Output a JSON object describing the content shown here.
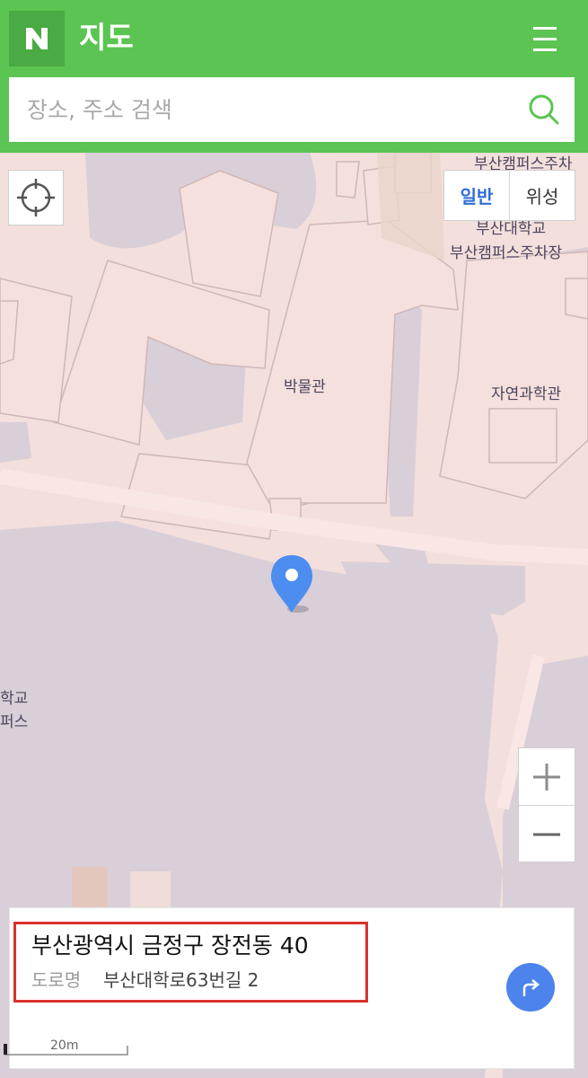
{
  "header": {
    "logo_letter": "N",
    "title": "지도",
    "menu_icon": "hamburger-menu-icon",
    "brand_color": "#5bc452"
  },
  "search": {
    "placeholder": "장소, 주소 검색",
    "value": "",
    "icon": "search-icon"
  },
  "map": {
    "map_type": {
      "options": [
        "일반",
        "위성"
      ],
      "selected": "일반"
    },
    "labels": {
      "parking_top": "부산캠퍼스주차",
      "university": "부산대학교",
      "parking": "부산캠퍼스주차장",
      "museum": "박물관",
      "science_college": "자연과학관",
      "left_edge_1": "학교",
      "left_edge_2": "퍼스"
    },
    "scale": "20m",
    "zoom": {
      "in_icon": "plus-icon",
      "out_icon": "minus-icon"
    },
    "locate_icon": "crosshair-icon",
    "marker_icon": "location-pin-icon",
    "marker_color": "#4c8df0"
  },
  "info": {
    "address": "부산광역시 금정구 장전동 40",
    "road_tag": "도로명",
    "road_address": "부산대학로63번길 2",
    "route_icon": "directions-icon",
    "highlight_color": "#d9322b"
  }
}
